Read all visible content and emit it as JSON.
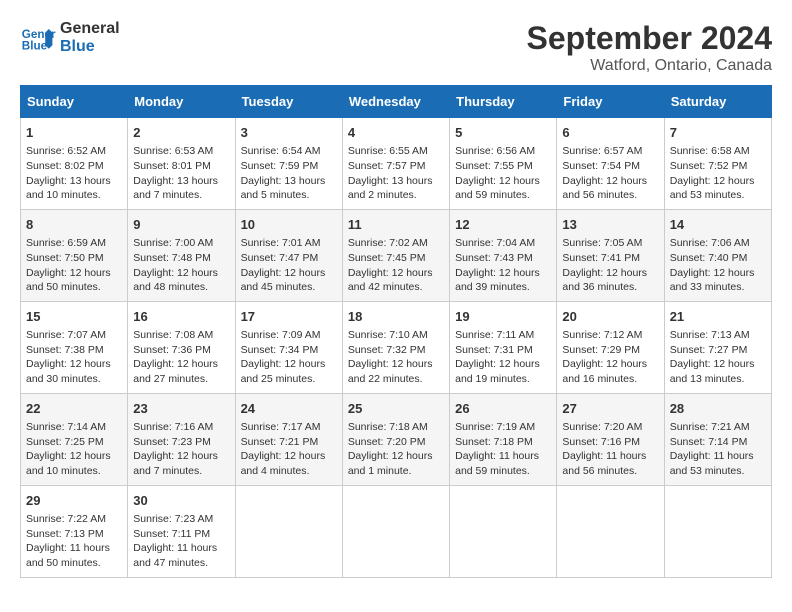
{
  "header": {
    "logo_line1": "General",
    "logo_line2": "Blue",
    "month": "September 2024",
    "location": "Watford, Ontario, Canada"
  },
  "weekdays": [
    "Sunday",
    "Monday",
    "Tuesday",
    "Wednesday",
    "Thursday",
    "Friday",
    "Saturday"
  ],
  "weeks": [
    [
      {
        "day": "1",
        "info": "Sunrise: 6:52 AM\nSunset: 8:02 PM\nDaylight: 13 hours and 10 minutes."
      },
      {
        "day": "2",
        "info": "Sunrise: 6:53 AM\nSunset: 8:01 PM\nDaylight: 13 hours and 7 minutes."
      },
      {
        "day": "3",
        "info": "Sunrise: 6:54 AM\nSunset: 7:59 PM\nDaylight: 13 hours and 5 minutes."
      },
      {
        "day": "4",
        "info": "Sunrise: 6:55 AM\nSunset: 7:57 PM\nDaylight: 13 hours and 2 minutes."
      },
      {
        "day": "5",
        "info": "Sunrise: 6:56 AM\nSunset: 7:55 PM\nDaylight: 12 hours and 59 minutes."
      },
      {
        "day": "6",
        "info": "Sunrise: 6:57 AM\nSunset: 7:54 PM\nDaylight: 12 hours and 56 minutes."
      },
      {
        "day": "7",
        "info": "Sunrise: 6:58 AM\nSunset: 7:52 PM\nDaylight: 12 hours and 53 minutes."
      }
    ],
    [
      {
        "day": "8",
        "info": "Sunrise: 6:59 AM\nSunset: 7:50 PM\nDaylight: 12 hours and 50 minutes."
      },
      {
        "day": "9",
        "info": "Sunrise: 7:00 AM\nSunset: 7:48 PM\nDaylight: 12 hours and 48 minutes."
      },
      {
        "day": "10",
        "info": "Sunrise: 7:01 AM\nSunset: 7:47 PM\nDaylight: 12 hours and 45 minutes."
      },
      {
        "day": "11",
        "info": "Sunrise: 7:02 AM\nSunset: 7:45 PM\nDaylight: 12 hours and 42 minutes."
      },
      {
        "day": "12",
        "info": "Sunrise: 7:04 AM\nSunset: 7:43 PM\nDaylight: 12 hours and 39 minutes."
      },
      {
        "day": "13",
        "info": "Sunrise: 7:05 AM\nSunset: 7:41 PM\nDaylight: 12 hours and 36 minutes."
      },
      {
        "day": "14",
        "info": "Sunrise: 7:06 AM\nSunset: 7:40 PM\nDaylight: 12 hours and 33 minutes."
      }
    ],
    [
      {
        "day": "15",
        "info": "Sunrise: 7:07 AM\nSunset: 7:38 PM\nDaylight: 12 hours and 30 minutes."
      },
      {
        "day": "16",
        "info": "Sunrise: 7:08 AM\nSunset: 7:36 PM\nDaylight: 12 hours and 27 minutes."
      },
      {
        "day": "17",
        "info": "Sunrise: 7:09 AM\nSunset: 7:34 PM\nDaylight: 12 hours and 25 minutes."
      },
      {
        "day": "18",
        "info": "Sunrise: 7:10 AM\nSunset: 7:32 PM\nDaylight: 12 hours and 22 minutes."
      },
      {
        "day": "19",
        "info": "Sunrise: 7:11 AM\nSunset: 7:31 PM\nDaylight: 12 hours and 19 minutes."
      },
      {
        "day": "20",
        "info": "Sunrise: 7:12 AM\nSunset: 7:29 PM\nDaylight: 12 hours and 16 minutes."
      },
      {
        "day": "21",
        "info": "Sunrise: 7:13 AM\nSunset: 7:27 PM\nDaylight: 12 hours and 13 minutes."
      }
    ],
    [
      {
        "day": "22",
        "info": "Sunrise: 7:14 AM\nSunset: 7:25 PM\nDaylight: 12 hours and 10 minutes."
      },
      {
        "day": "23",
        "info": "Sunrise: 7:16 AM\nSunset: 7:23 PM\nDaylight: 12 hours and 7 minutes."
      },
      {
        "day": "24",
        "info": "Sunrise: 7:17 AM\nSunset: 7:21 PM\nDaylight: 12 hours and 4 minutes."
      },
      {
        "day": "25",
        "info": "Sunrise: 7:18 AM\nSunset: 7:20 PM\nDaylight: 12 hours and 1 minute."
      },
      {
        "day": "26",
        "info": "Sunrise: 7:19 AM\nSunset: 7:18 PM\nDaylight: 11 hours and 59 minutes."
      },
      {
        "day": "27",
        "info": "Sunrise: 7:20 AM\nSunset: 7:16 PM\nDaylight: 11 hours and 56 minutes."
      },
      {
        "day": "28",
        "info": "Sunrise: 7:21 AM\nSunset: 7:14 PM\nDaylight: 11 hours and 53 minutes."
      }
    ],
    [
      {
        "day": "29",
        "info": "Sunrise: 7:22 AM\nSunset: 7:13 PM\nDaylight: 11 hours and 50 minutes."
      },
      {
        "day": "30",
        "info": "Sunrise: 7:23 AM\nSunset: 7:11 PM\nDaylight: 11 hours and 47 minutes."
      },
      {
        "day": "",
        "info": ""
      },
      {
        "day": "",
        "info": ""
      },
      {
        "day": "",
        "info": ""
      },
      {
        "day": "",
        "info": ""
      },
      {
        "day": "",
        "info": ""
      }
    ]
  ]
}
